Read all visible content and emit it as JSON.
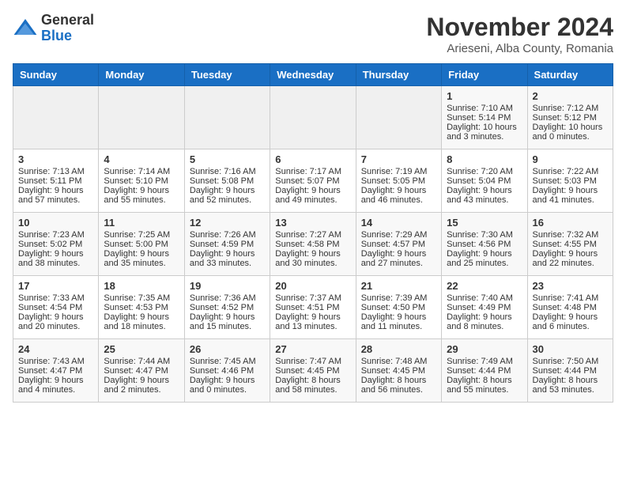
{
  "logo": {
    "general": "General",
    "blue": "Blue"
  },
  "title": "November 2024",
  "location": "Arieseni, Alba County, Romania",
  "weekdays": [
    "Sunday",
    "Monday",
    "Tuesday",
    "Wednesday",
    "Thursday",
    "Friday",
    "Saturday"
  ],
  "weeks": [
    [
      {
        "day": "",
        "info": ""
      },
      {
        "day": "",
        "info": ""
      },
      {
        "day": "",
        "info": ""
      },
      {
        "day": "",
        "info": ""
      },
      {
        "day": "",
        "info": ""
      },
      {
        "day": "1",
        "info": "Sunrise: 7:10 AM\nSunset: 5:14 PM\nDaylight: 10 hours\nand 3 minutes."
      },
      {
        "day": "2",
        "info": "Sunrise: 7:12 AM\nSunset: 5:12 PM\nDaylight: 10 hours\nand 0 minutes."
      }
    ],
    [
      {
        "day": "3",
        "info": "Sunrise: 7:13 AM\nSunset: 5:11 PM\nDaylight: 9 hours\nand 57 minutes."
      },
      {
        "day": "4",
        "info": "Sunrise: 7:14 AM\nSunset: 5:10 PM\nDaylight: 9 hours\nand 55 minutes."
      },
      {
        "day": "5",
        "info": "Sunrise: 7:16 AM\nSunset: 5:08 PM\nDaylight: 9 hours\nand 52 minutes."
      },
      {
        "day": "6",
        "info": "Sunrise: 7:17 AM\nSunset: 5:07 PM\nDaylight: 9 hours\nand 49 minutes."
      },
      {
        "day": "7",
        "info": "Sunrise: 7:19 AM\nSunset: 5:05 PM\nDaylight: 9 hours\nand 46 minutes."
      },
      {
        "day": "8",
        "info": "Sunrise: 7:20 AM\nSunset: 5:04 PM\nDaylight: 9 hours\nand 43 minutes."
      },
      {
        "day": "9",
        "info": "Sunrise: 7:22 AM\nSunset: 5:03 PM\nDaylight: 9 hours\nand 41 minutes."
      }
    ],
    [
      {
        "day": "10",
        "info": "Sunrise: 7:23 AM\nSunset: 5:02 PM\nDaylight: 9 hours\nand 38 minutes."
      },
      {
        "day": "11",
        "info": "Sunrise: 7:25 AM\nSunset: 5:00 PM\nDaylight: 9 hours\nand 35 minutes."
      },
      {
        "day": "12",
        "info": "Sunrise: 7:26 AM\nSunset: 4:59 PM\nDaylight: 9 hours\nand 33 minutes."
      },
      {
        "day": "13",
        "info": "Sunrise: 7:27 AM\nSunset: 4:58 PM\nDaylight: 9 hours\nand 30 minutes."
      },
      {
        "day": "14",
        "info": "Sunrise: 7:29 AM\nSunset: 4:57 PM\nDaylight: 9 hours\nand 27 minutes."
      },
      {
        "day": "15",
        "info": "Sunrise: 7:30 AM\nSunset: 4:56 PM\nDaylight: 9 hours\nand 25 minutes."
      },
      {
        "day": "16",
        "info": "Sunrise: 7:32 AM\nSunset: 4:55 PM\nDaylight: 9 hours\nand 22 minutes."
      }
    ],
    [
      {
        "day": "17",
        "info": "Sunrise: 7:33 AM\nSunset: 4:54 PM\nDaylight: 9 hours\nand 20 minutes."
      },
      {
        "day": "18",
        "info": "Sunrise: 7:35 AM\nSunset: 4:53 PM\nDaylight: 9 hours\nand 18 minutes."
      },
      {
        "day": "19",
        "info": "Sunrise: 7:36 AM\nSunset: 4:52 PM\nDaylight: 9 hours\nand 15 minutes."
      },
      {
        "day": "20",
        "info": "Sunrise: 7:37 AM\nSunset: 4:51 PM\nDaylight: 9 hours\nand 13 minutes."
      },
      {
        "day": "21",
        "info": "Sunrise: 7:39 AM\nSunset: 4:50 PM\nDaylight: 9 hours\nand 11 minutes."
      },
      {
        "day": "22",
        "info": "Sunrise: 7:40 AM\nSunset: 4:49 PM\nDaylight: 9 hours\nand 8 minutes."
      },
      {
        "day": "23",
        "info": "Sunrise: 7:41 AM\nSunset: 4:48 PM\nDaylight: 9 hours\nand 6 minutes."
      }
    ],
    [
      {
        "day": "24",
        "info": "Sunrise: 7:43 AM\nSunset: 4:47 PM\nDaylight: 9 hours\nand 4 minutes."
      },
      {
        "day": "25",
        "info": "Sunrise: 7:44 AM\nSunset: 4:47 PM\nDaylight: 9 hours\nand 2 minutes."
      },
      {
        "day": "26",
        "info": "Sunrise: 7:45 AM\nSunset: 4:46 PM\nDaylight: 9 hours\nand 0 minutes."
      },
      {
        "day": "27",
        "info": "Sunrise: 7:47 AM\nSunset: 4:45 PM\nDaylight: 8 hours\nand 58 minutes."
      },
      {
        "day": "28",
        "info": "Sunrise: 7:48 AM\nSunset: 4:45 PM\nDaylight: 8 hours\nand 56 minutes."
      },
      {
        "day": "29",
        "info": "Sunrise: 7:49 AM\nSunset: 4:44 PM\nDaylight: 8 hours\nand 55 minutes."
      },
      {
        "day": "30",
        "info": "Sunrise: 7:50 AM\nSunset: 4:44 PM\nDaylight: 8 hours\nand 53 minutes."
      }
    ]
  ]
}
